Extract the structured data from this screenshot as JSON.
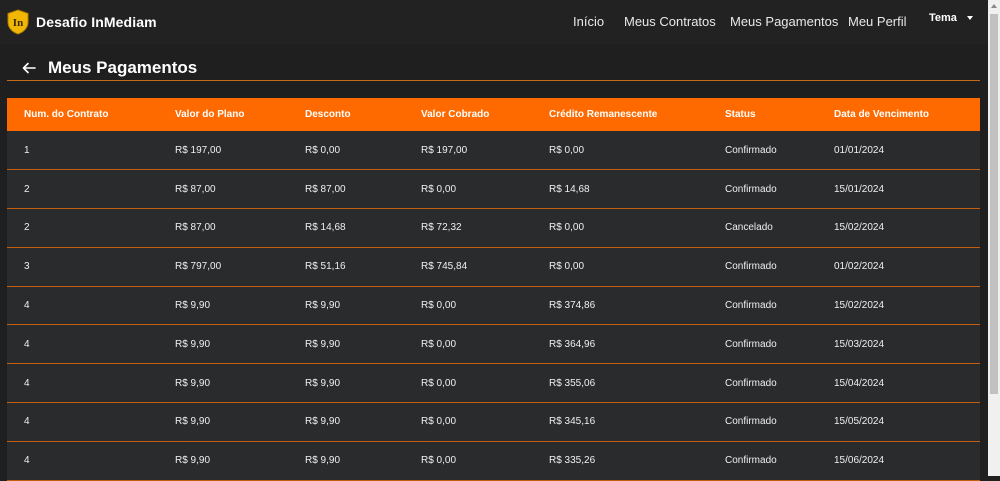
{
  "brand": {
    "name": "Desafio InMediam",
    "logo_text": "In"
  },
  "nav": {
    "links": [
      "Início",
      "Meus Contratos",
      "Meus Pagamentos",
      "Meu Perfil"
    ],
    "theme_label": "Tema"
  },
  "page": {
    "title": "Meus Pagamentos"
  },
  "table": {
    "headers": [
      "Num. do Contrato",
      "Valor do Plano",
      "Desconto",
      "Valor Cobrado",
      "Crédito Remanescente",
      "Status",
      "Data de Vencimento"
    ],
    "rows": [
      [
        "1",
        "R$ 197,00",
        "R$ 0,00",
        "R$ 197,00",
        "R$ 0,00",
        "Confirmado",
        "01/01/2024"
      ],
      [
        "2",
        "R$ 87,00",
        "R$ 87,00",
        "R$ 0,00",
        "R$ 14,68",
        "Confirmado",
        "15/01/2024"
      ],
      [
        "2",
        "R$ 87,00",
        "R$ 14,68",
        "R$ 72,32",
        "R$ 0,00",
        "Cancelado",
        "15/02/2024"
      ],
      [
        "3",
        "R$ 797,00",
        "R$ 51,16",
        "R$ 745,84",
        "R$ 0,00",
        "Confirmado",
        "01/02/2024"
      ],
      [
        "4",
        "R$ 9,90",
        "R$ 9,90",
        "R$ 0,00",
        "R$ 374,86",
        "Confirmado",
        "15/02/2024"
      ],
      [
        "4",
        "R$ 9,90",
        "R$ 9,90",
        "R$ 0,00",
        "R$ 364,96",
        "Confirmado",
        "15/03/2024"
      ],
      [
        "4",
        "R$ 9,90",
        "R$ 9,90",
        "R$ 0,00",
        "R$ 355,06",
        "Confirmado",
        "15/04/2024"
      ],
      [
        "4",
        "R$ 9,90",
        "R$ 9,90",
        "R$ 0,00",
        "R$ 345,16",
        "Confirmado",
        "15/05/2024"
      ],
      [
        "4",
        "R$ 9,90",
        "R$ 9,90",
        "R$ 0,00",
        "R$ 335,26",
        "Confirmado",
        "15/06/2024"
      ]
    ]
  },
  "colors": {
    "accent": "#ff6a00",
    "navbar": "#222222",
    "background": "#1f1f1f",
    "row": "#2a2b2d"
  }
}
